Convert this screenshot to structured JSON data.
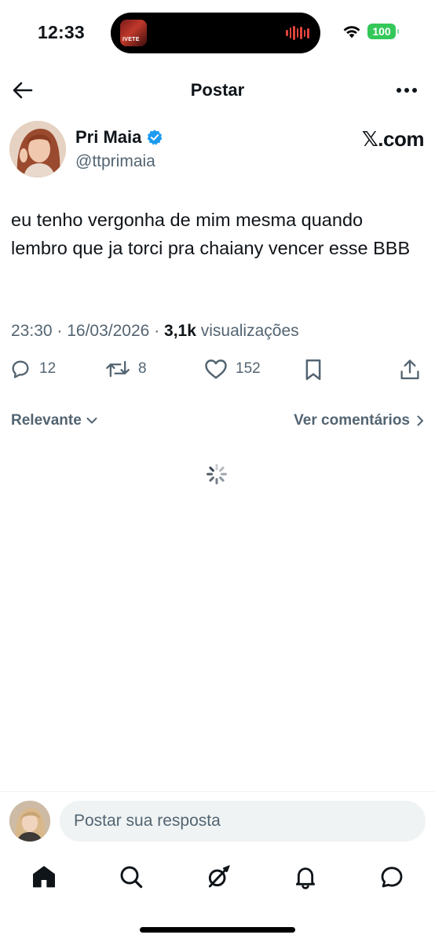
{
  "status_bar": {
    "time": "12:33",
    "battery": "100",
    "island_art_text": "IVETE"
  },
  "header": {
    "title": "Postar"
  },
  "author": {
    "name": "Pri Maia",
    "handle": "@ttprimaia",
    "verified": true,
    "brand": "𝕏.com"
  },
  "post": {
    "text": "eu tenho vergonha de mim mesma quando lembro que ja torci pra chaiany vencer esse BBB",
    "time": "23:30",
    "date": "16/03/2026",
    "views": "3,1k",
    "views_label": "visualizações"
  },
  "actions": {
    "replies": "12",
    "reposts": "8",
    "likes": "152"
  },
  "filter": {
    "sort_label": "Relevante",
    "view_comments_label": "Ver comentários"
  },
  "reply": {
    "placeholder": "Postar sua resposta"
  },
  "tabs": [
    {
      "icon": "home-icon"
    },
    {
      "icon": "search-icon"
    },
    {
      "icon": "grok-icon"
    },
    {
      "icon": "bell-icon"
    },
    {
      "icon": "messages-icon"
    }
  ],
  "colors": {
    "text": "#0f1419",
    "secondary": "#536471",
    "verified": "#1d9bf0",
    "battery": "#34c759",
    "input_bg": "#eff3f4"
  }
}
